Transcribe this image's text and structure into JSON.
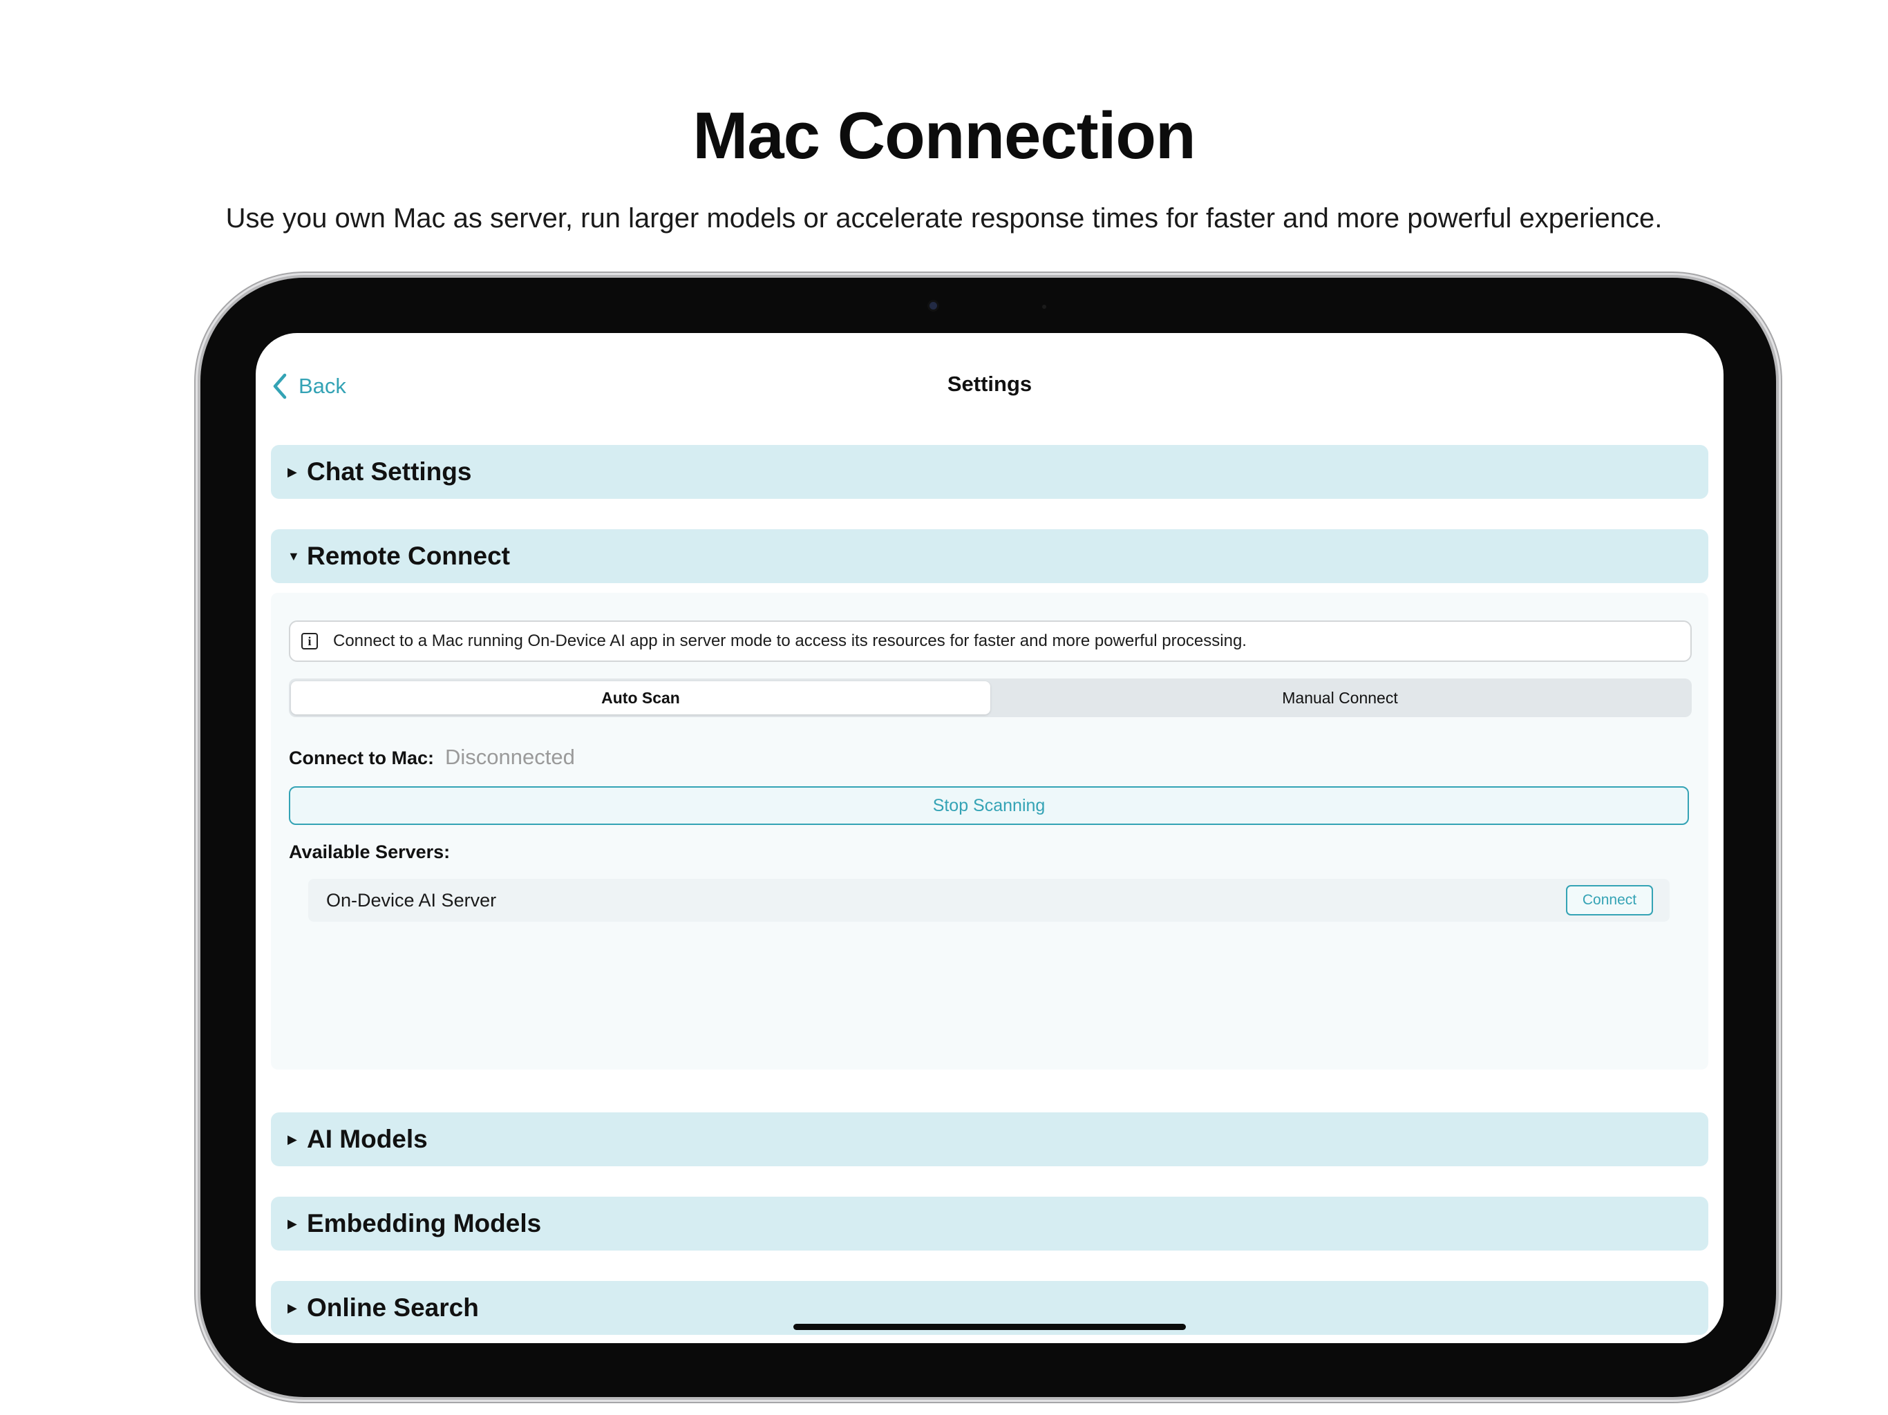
{
  "headline": "Mac Connection",
  "subline": "Use you own Mac as server, run larger models or accelerate response times for faster and more powerful experience.",
  "nav": {
    "back_label": "Back",
    "title": "Settings"
  },
  "sections": {
    "chat_settings": "Chat Settings",
    "remote_connect": "Remote Connect",
    "ai_models": "AI Models",
    "embedding_models": "Embedding Models",
    "online_search": "Online Search"
  },
  "remote": {
    "info_text": "Connect to a Mac running On-Device AI app in server mode to access its resources for faster and more powerful processing.",
    "tabs": [
      "Auto Scan",
      "Manual Connect"
    ],
    "selected_tab": "Auto Scan",
    "connect_label": "Connect to Mac:",
    "connect_status": "Disconnected",
    "stop_button": "Stop Scanning",
    "available_label": "Available Servers:",
    "servers": [
      {
        "name": "On-Device AI Server",
        "action": "Connect"
      }
    ]
  },
  "colors": {
    "accent": "#34a3b5",
    "section_bg": "#d6edf2",
    "status_gray": "#9a9a9a"
  },
  "icons": {
    "back": "chevron-left-icon",
    "collapsed": "triangle-right-icon",
    "expanded": "triangle-down-icon",
    "info": "info-icon"
  }
}
